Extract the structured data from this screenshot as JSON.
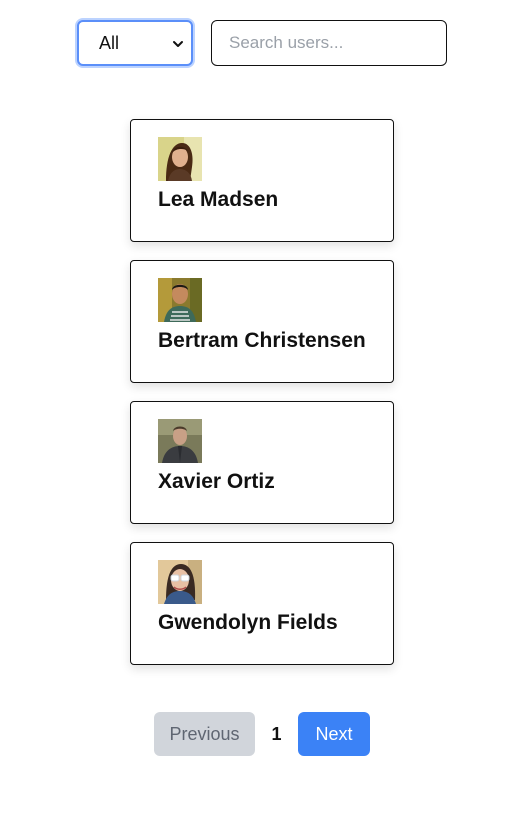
{
  "filter": {
    "selected": "All",
    "chevron_icon": "chevron-down-icon"
  },
  "search": {
    "placeholder": "Search users...",
    "value": ""
  },
  "users": [
    {
      "name": "Lea Madsen",
      "avatar": "avatar-photo"
    },
    {
      "name": "Bertram Christensen",
      "avatar": "avatar-photo"
    },
    {
      "name": "Xavier Ortiz",
      "avatar": "avatar-photo"
    },
    {
      "name": "Gwendolyn Fields",
      "avatar": "avatar-photo"
    }
  ],
  "pagination": {
    "previous_label": "Previous",
    "current_page": "1",
    "next_label": "Next"
  },
  "colors": {
    "accent": "#3b82f6",
    "disabled": "#d1d5db"
  }
}
